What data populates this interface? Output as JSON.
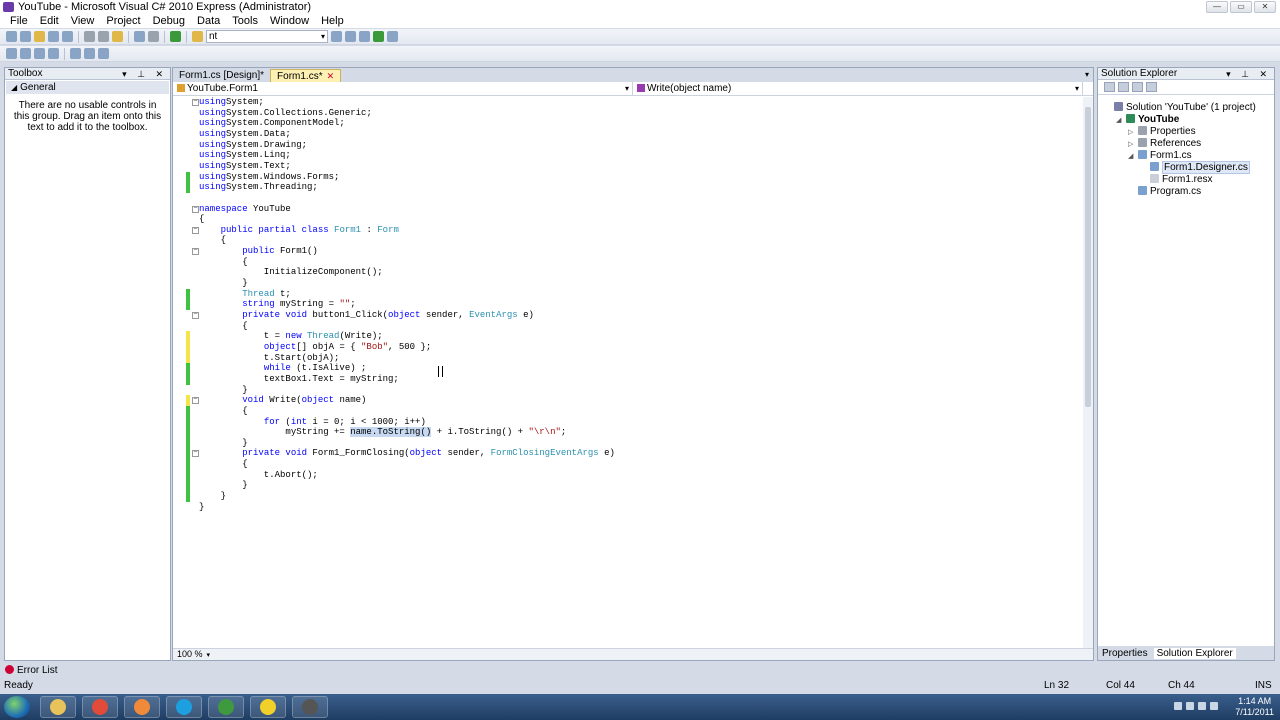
{
  "window": {
    "title": "YouTube - Microsoft Visual C# 2010 Express (Administrator)",
    "controls": [
      "—",
      "▭",
      "✕"
    ]
  },
  "menu": [
    "File",
    "Edit",
    "View",
    "Project",
    "Debug",
    "Data",
    "Tools",
    "Window",
    "Help"
  ],
  "toolbar": {
    "find_combo_value": "nt"
  },
  "toolbox": {
    "title": "Toolbox",
    "header_icons": "▾ ⊥ ✕",
    "group": "General",
    "empty_message": "There are no usable controls in this group. Drag an item onto this text to add it to the toolbox."
  },
  "editor": {
    "tabs": [
      {
        "label": "Form1.cs [Design]*",
        "active": false
      },
      {
        "label": "Form1.cs*",
        "active": true
      }
    ],
    "nav_left": "YouTube.Form1",
    "nav_right": "Write(object name)",
    "zoom": "100 %"
  },
  "code": [
    {
      "t": [
        [
          "kw",
          "using"
        ],
        [
          "",
          "System;"
        ]
      ],
      "mark": "",
      "fold": "−"
    },
    {
      "t": [
        [
          "kw",
          "using"
        ],
        [
          "",
          "System.Collections.Generic;"
        ]
      ],
      "mark": "",
      "fold": ""
    },
    {
      "t": [
        [
          "kw",
          "using"
        ],
        [
          "",
          "System.ComponentModel;"
        ]
      ],
      "mark": "",
      "fold": ""
    },
    {
      "t": [
        [
          "kw",
          "using"
        ],
        [
          "",
          "System.Data;"
        ]
      ],
      "mark": "",
      "fold": ""
    },
    {
      "t": [
        [
          "kw",
          "using"
        ],
        [
          "",
          "System.Drawing;"
        ]
      ],
      "mark": "",
      "fold": ""
    },
    {
      "t": [
        [
          "kw",
          "using"
        ],
        [
          "",
          "System.Linq;"
        ]
      ],
      "mark": "",
      "fold": ""
    },
    {
      "t": [
        [
          "kw",
          "using"
        ],
        [
          "",
          "System.Text;"
        ]
      ],
      "mark": "",
      "fold": ""
    },
    {
      "t": [
        [
          "kw",
          "using"
        ],
        [
          "",
          "System.Windows.Forms;"
        ]
      ],
      "mark": "green",
      "fold": ""
    },
    {
      "t": [
        [
          "kw",
          "using"
        ],
        [
          "",
          "System.Threading;"
        ]
      ],
      "mark": "green",
      "fold": ""
    },
    {
      "t": [],
      "mark": "",
      "fold": ""
    },
    {
      "t": [
        [
          "kw",
          "namespace"
        ],
        [
          "",
          " YouTube"
        ]
      ],
      "mark": "",
      "fold": "−"
    },
    {
      "t": [
        [
          "",
          "{"
        ]
      ],
      "mark": "",
      "fold": ""
    },
    {
      "t": [
        [
          "",
          "    "
        ],
        [
          "kw",
          "public partial class"
        ],
        [
          "",
          " "
        ],
        [
          "ty",
          "Form1"
        ],
        [
          "",
          " : "
        ],
        [
          "ty",
          "Form"
        ]
      ],
      "mark": "",
      "fold": "−"
    },
    {
      "t": [
        [
          "",
          "    {"
        ]
      ],
      "mark": "",
      "fold": ""
    },
    {
      "t": [
        [
          "",
          "        "
        ],
        [
          "kw",
          "public"
        ],
        [
          "",
          " Form1()"
        ]
      ],
      "mark": "",
      "fold": "−"
    },
    {
      "t": [
        [
          "",
          "        {"
        ]
      ],
      "mark": "",
      "fold": ""
    },
    {
      "t": [
        [
          "",
          "            InitializeComponent();"
        ]
      ],
      "mark": "",
      "fold": ""
    },
    {
      "t": [
        [
          "",
          "        }"
        ]
      ],
      "mark": "",
      "fold": ""
    },
    {
      "t": [
        [
          "",
          "        "
        ],
        [
          "ty",
          "Thread"
        ],
        [
          "",
          " t;"
        ]
      ],
      "mark": "green",
      "fold": ""
    },
    {
      "t": [
        [
          "",
          "        "
        ],
        [
          "kw",
          "string"
        ],
        [
          "",
          " myString = "
        ],
        [
          "st",
          "\"\""
        ],
        [
          "",
          ";"
        ]
      ],
      "mark": "green",
      "fold": ""
    },
    {
      "t": [
        [
          "",
          "        "
        ],
        [
          "kw",
          "private void"
        ],
        [
          "",
          " button1_Click("
        ],
        [
          "kw",
          "object"
        ],
        [
          "",
          " sender, "
        ],
        [
          "ty",
          "EventArgs"
        ],
        [
          "",
          " e)"
        ]
      ],
      "mark": "",
      "fold": "−"
    },
    {
      "t": [
        [
          "",
          "        {"
        ]
      ],
      "mark": "",
      "fold": ""
    },
    {
      "t": [
        [
          "",
          "            t = "
        ],
        [
          "kw",
          "new"
        ],
        [
          "",
          " "
        ],
        [
          "ty",
          "Thread"
        ],
        [
          "",
          "(Write);"
        ]
      ],
      "mark": "yellow",
      "fold": ""
    },
    {
      "t": [
        [
          "",
          "            "
        ],
        [
          "kw",
          "object"
        ],
        [
          "",
          "[] objA = { "
        ],
        [
          "st",
          "\"Bob\""
        ],
        [
          "",
          ", 500 };"
        ]
      ],
      "mark": "yellow",
      "fold": ""
    },
    {
      "t": [
        [
          "",
          "            t.Start(objA);"
        ]
      ],
      "mark": "yellow",
      "fold": ""
    },
    {
      "t": [
        [
          "",
          "            "
        ],
        [
          "kw",
          "while"
        ],
        [
          "",
          " (t.IsAlive) ;"
        ]
      ],
      "mark": "green",
      "fold": ""
    },
    {
      "t": [
        [
          "",
          "            textBox1.Text = myString;"
        ]
      ],
      "mark": "green",
      "fold": ""
    },
    {
      "t": [
        [
          "",
          "        }"
        ]
      ],
      "mark": "",
      "fold": ""
    },
    {
      "t": [
        [
          "",
          "        "
        ],
        [
          "kw",
          "void"
        ],
        [
          "",
          " Write("
        ],
        [
          "kw",
          "object"
        ],
        [
          "",
          " name)"
        ]
      ],
      "mark": "yellow",
      "fold": "−"
    },
    {
      "t": [
        [
          "",
          "        {"
        ]
      ],
      "mark": "green",
      "fold": ""
    },
    {
      "t": [
        [
          "",
          "            "
        ],
        [
          "kw",
          "for"
        ],
        [
          "",
          " ("
        ],
        [
          "kw",
          "int"
        ],
        [
          "",
          " i = 0; i < 1000; i++)"
        ]
      ],
      "mark": "green",
      "fold": ""
    },
    {
      "t": [
        [
          "",
          "                myString += "
        ],
        [
          "sel",
          "name.ToString()"
        ],
        [
          "",
          " + i.ToString() + "
        ],
        [
          "st",
          "\"\\r\\n\""
        ],
        [
          "",
          ";"
        ]
      ],
      "mark": "green",
      "fold": ""
    },
    {
      "t": [
        [
          "",
          "        }"
        ]
      ],
      "mark": "green",
      "fold": ""
    },
    {
      "t": [
        [
          "",
          "        "
        ],
        [
          "kw",
          "private void"
        ],
        [
          "",
          " Form1_FormClosing("
        ],
        [
          "kw",
          "object"
        ],
        [
          "",
          " sender, "
        ],
        [
          "ty",
          "FormClosingEventArgs"
        ],
        [
          "",
          " e)"
        ]
      ],
      "mark": "green",
      "fold": "−"
    },
    {
      "t": [
        [
          "",
          "        {"
        ]
      ],
      "mark": "green",
      "fold": ""
    },
    {
      "t": [
        [
          "",
          "            t.Abort();"
        ]
      ],
      "mark": "green",
      "fold": ""
    },
    {
      "t": [
        [
          "",
          "        }"
        ]
      ],
      "mark": "green",
      "fold": ""
    },
    {
      "t": [
        [
          "",
          "    }"
        ]
      ],
      "mark": "green",
      "fold": ""
    },
    {
      "t": [
        [
          "",
          "}"
        ]
      ],
      "mark": "",
      "fold": ""
    }
  ],
  "solution_explorer": {
    "title": "Solution Explorer",
    "header_icons": "▾ ⊥ ✕",
    "tree": [
      {
        "label": "Solution 'YouTube' (1 project)",
        "level": 0,
        "exp": "",
        "color": "#7a7fa8",
        "bold": false,
        "selected": false
      },
      {
        "label": "YouTube",
        "level": 1,
        "exp": "◢",
        "color": "#2e8b57",
        "bold": true,
        "selected": false
      },
      {
        "label": "Properties",
        "level": 2,
        "exp": "▷",
        "color": "#9aa2ad",
        "bold": false,
        "selected": false
      },
      {
        "label": "References",
        "level": 2,
        "exp": "▷",
        "color": "#9aa2ad",
        "bold": false,
        "selected": false
      },
      {
        "label": "Form1.cs",
        "level": 2,
        "exp": "◢",
        "color": "#7aa0d0",
        "bold": false,
        "selected": false
      },
      {
        "label": "Form1.Designer.cs",
        "level": 3,
        "exp": "",
        "color": "#7aa0d0",
        "bold": false,
        "selected": true
      },
      {
        "label": "Form1.resx",
        "level": 3,
        "exp": "",
        "color": "#c9ced8",
        "bold": false,
        "selected": false
      },
      {
        "label": "Program.cs",
        "level": 2,
        "exp": "",
        "color": "#7aa0d0",
        "bold": false,
        "selected": false
      }
    ],
    "tabs": [
      "Properties",
      "Solution Explorer"
    ]
  },
  "error_list": "Error List",
  "status": {
    "ready": "Ready",
    "ln": "Ln 32",
    "col": "Col 44",
    "ch": "Ch 44",
    "ins": "INS"
  },
  "taskbar": {
    "apps": [
      {
        "name": "explorer-app",
        "color": "#e8c25a"
      },
      {
        "name": "chrome-app",
        "color": "#e04b3a"
      },
      {
        "name": "paint-app",
        "color": "#f08a3a"
      },
      {
        "name": "skype-app",
        "color": "#1ea0e0"
      },
      {
        "name": "visual-csharp-app",
        "color": "#3f9a3f"
      },
      {
        "name": "recorder-app",
        "color": "#f2d02a"
      },
      {
        "name": "media-app",
        "color": "#555555"
      }
    ],
    "time": "1:14 AM",
    "date": "7/11/2011"
  },
  "colors": {
    "keyword": "#0000ff",
    "type": "#2b91af",
    "string": "#a31515",
    "change_saved": "#3fc23f",
    "change_unsaved": "#f5e34a"
  }
}
